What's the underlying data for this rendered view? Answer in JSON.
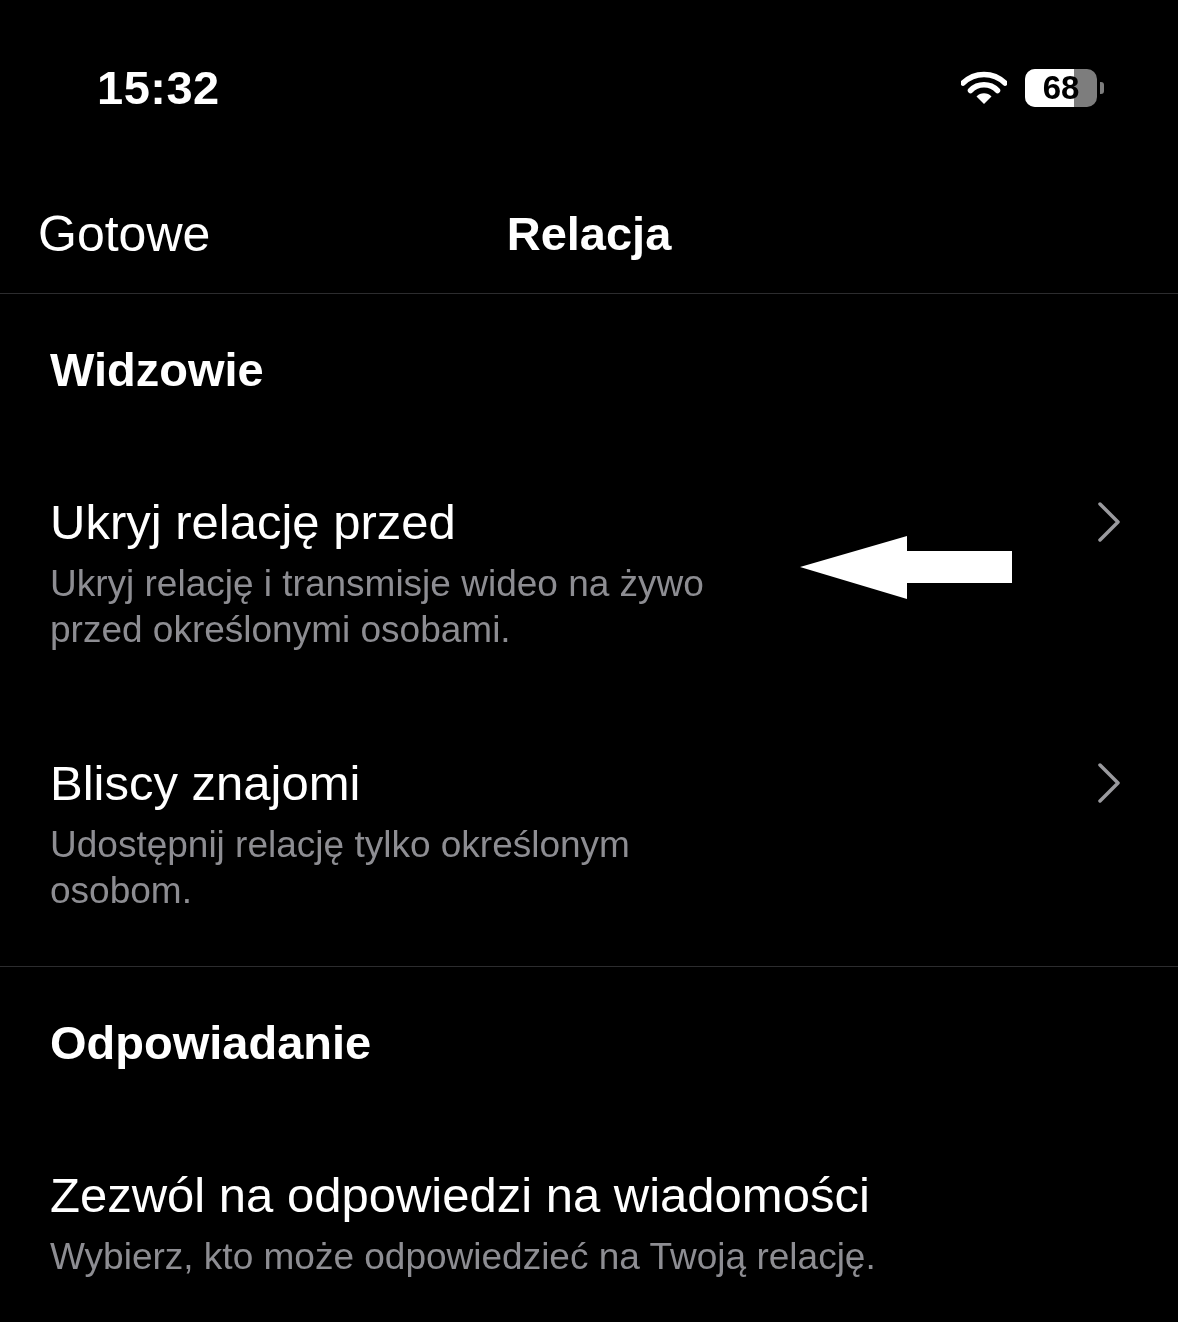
{
  "status_bar": {
    "time": "15:32",
    "battery_percent": "68"
  },
  "nav": {
    "left_button": "Gotowe",
    "title": "Relacja"
  },
  "sections": [
    {
      "title": "Widzowie",
      "items": [
        {
          "title": "Ukryj relację przed",
          "subtitle": "Ukryj relację i transmisje wideo na żywo przed określonymi osobami.",
          "chevron": true,
          "pointer_arrow": true
        },
        {
          "title": "Bliscy znajomi",
          "subtitle": "Udostępnij relację tylko określonym osobom.",
          "chevron": true,
          "pointer_arrow": false
        }
      ]
    },
    {
      "title": "Odpowiadanie",
      "items": [
        {
          "title": "Zezwól na odpowiedzi na wiadomości",
          "subtitle": "Wybierz, kto może odpowiedzieć na Twoją relację.",
          "chevron": false,
          "pointer_arrow": false
        }
      ]
    }
  ]
}
